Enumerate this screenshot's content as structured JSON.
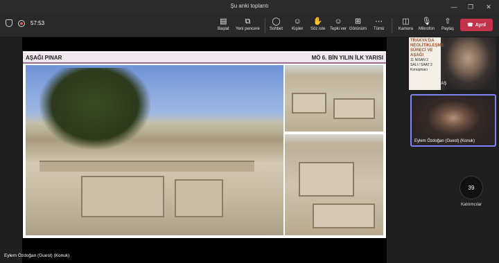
{
  "window": {
    "title": "Şu anki toplantı"
  },
  "meeting": {
    "duration": "57:53"
  },
  "toolbar": {
    "start": "Başlat",
    "new_window": "Yeni pencere",
    "chat": "Sohbet",
    "people": "Kişiler",
    "raise_hand": "Söz iste",
    "react": "Tepki ver",
    "view": "Görünüm",
    "more": "Tümü",
    "camera": "Kamera",
    "mic": "Mikrofon",
    "share": "Paylaş",
    "leave": "Ayrıl"
  },
  "slide": {
    "left_title": "AŞAĞI PINAR",
    "right_title": "MÖ 6. BİN YILIN İLK YARISI"
  },
  "participants": {
    "poster_lines": [
      "TRAKYA'DA",
      "NEOLİTİKLEŞME",
      "SÜRECİ VE AŞAĞI"
    ],
    "poster_date": "11 NİSAN 2",
    "poster_time": "SALI / SAAT 2",
    "poster_small": "Konuşmacı",
    "top_name": "AHMET YARAŞ",
    "selected_name": "Eylem Özdoğan (Guest) (Konuk)",
    "count": "39",
    "count_label": "Katılımcılar"
  },
  "stage": {
    "speaker_name": "Eylem Özdoğan (Guest) (Konuk)"
  },
  "colors": {
    "leave": "#c4314b",
    "accent": "#7f85f5",
    "slide_bar": "#9a6e8a"
  }
}
